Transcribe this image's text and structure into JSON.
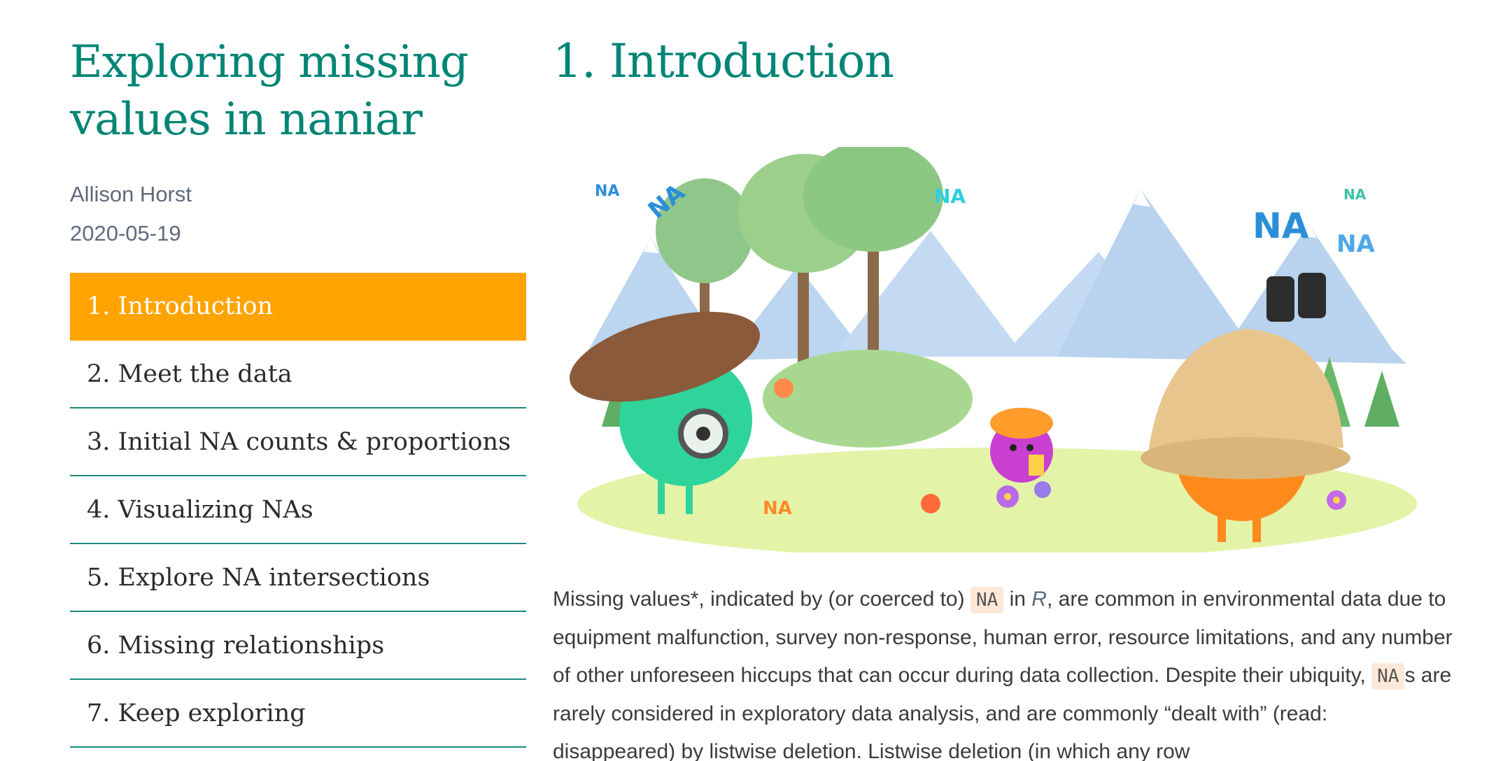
{
  "sidebar": {
    "title": "Exploring missing values in naniar",
    "author": "Allison Horst",
    "date": "2020-05-19",
    "toc": [
      {
        "label": "1. Introduction",
        "active": true
      },
      {
        "label": "2. Meet the data",
        "active": false
      },
      {
        "label": "3. Initial NA counts & proportions",
        "active": false
      },
      {
        "label": "4. Visualizing NAs",
        "active": false
      },
      {
        "label": "5. Explore NA intersections",
        "active": false
      },
      {
        "label": "6. Missing relationships",
        "active": false
      },
      {
        "label": "7. Keep exploring",
        "active": false
      }
    ]
  },
  "main": {
    "section_title": "1. Introduction",
    "illustration_label": "NA",
    "paragraph": {
      "seg1": "Missing values*, indicated by (or coerced to) ",
      "code1": "NA",
      "seg2": " in ",
      "r_link": "R",
      "seg3": ", are common in environmental data due to equipment malfunction, survey non-response, human error, resource limitations, and any number of other unforeseen hiccups that can occur during data collection. Despite their ubiquity, ",
      "code2": "NA",
      "seg4": "s are rarely considered in exploratory data analysis, and are commonly “dealt with” (read: disappeared) by listwise deletion. Listwise deletion (in which any row"
    }
  },
  "colors": {
    "accent": "#008575",
    "active_bg": "#ffa300",
    "code_bg": "#fde9d9"
  }
}
